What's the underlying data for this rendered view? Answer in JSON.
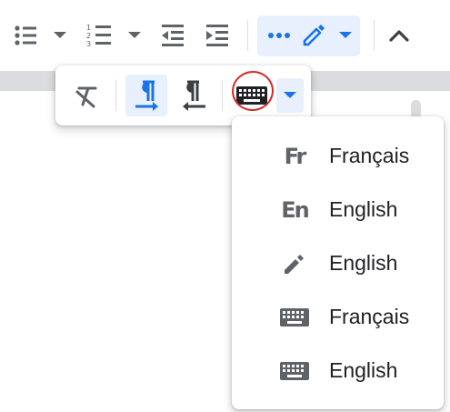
{
  "toolbar": {
    "buttons": [
      {
        "icon": "bulleted-list-icon"
      },
      {
        "icon": "bulleted-list-dropdown-icon"
      },
      {
        "icon": "numbered-list-icon"
      },
      {
        "icon": "numbered-list-dropdown-icon"
      },
      {
        "icon": "decrease-indent-icon"
      },
      {
        "icon": "increase-indent-icon"
      },
      {
        "icon": "more-options-icon"
      },
      {
        "icon": "pencil-icon"
      },
      {
        "icon": "input-tools-dropdown-icon"
      },
      {
        "icon": "collapse-toolbar-icon"
      }
    ],
    "accent_color": "#1a73e8",
    "active_bg": "#e8f0fe"
  },
  "subtoolbar": {
    "buttons": [
      {
        "icon": "clear-formatting-icon"
      },
      {
        "icon": "left-to-right-text-icon",
        "active": true
      },
      {
        "icon": "right-to-left-text-icon"
      },
      {
        "icon": "keyboard-icon"
      },
      {
        "icon": "keyboard-dropdown-icon"
      }
    ],
    "annotation_color": "#d6292c"
  },
  "input_tools_menu": {
    "items": [
      {
        "label": "Français",
        "icon": "french-transliteration-icon",
        "glyph": "Fr"
      },
      {
        "label": "English",
        "icon": "english-transliteration-icon",
        "glyph": "En"
      },
      {
        "label": "English",
        "icon": "handwriting-pencil-icon"
      },
      {
        "label": "Français",
        "icon": "keyboard-icon"
      },
      {
        "label": "English",
        "icon": "keyboard-icon"
      }
    ]
  }
}
